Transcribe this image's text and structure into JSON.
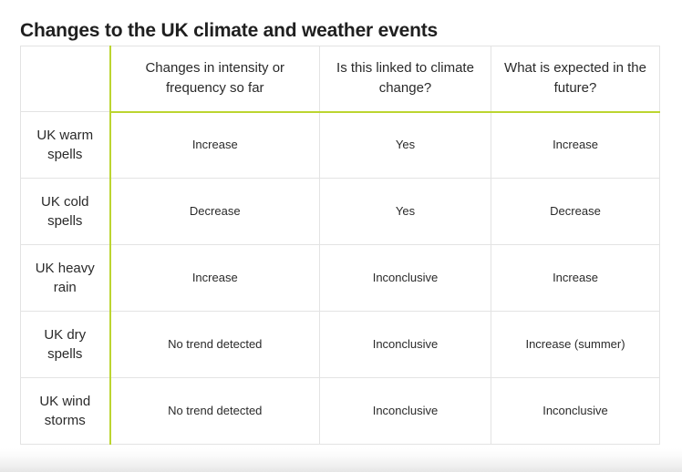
{
  "page": {
    "title": "Changes to the UK climate and weather events",
    "accent_color": "#bcd530",
    "border_color": "#e3e3e3",
    "text_color": "#2a2a2a"
  },
  "table": {
    "corner_header": "",
    "columns": [
      "",
      "Changes in intensity or frequency so far",
      "Is this linked to climate change?",
      "What is expected in the future?"
    ],
    "rows": [
      {
        "label": "UK warm spells",
        "cells": [
          "Increase",
          "Yes",
          "Increase"
        ]
      },
      {
        "label": "UK cold spells",
        "cells": [
          "Decrease",
          "Yes",
          "Decrease"
        ]
      },
      {
        "label": "UK heavy rain",
        "cells": [
          "Increase",
          "Inconclusive",
          "Increase"
        ]
      },
      {
        "label": "UK dry spells",
        "cells": [
          "No trend detected",
          "Inconclusive",
          "Increase (summer)"
        ]
      },
      {
        "label": "UK wind storms",
        "cells": [
          "No trend detected",
          "Inconclusive",
          "Inconclusive"
        ]
      }
    ]
  }
}
